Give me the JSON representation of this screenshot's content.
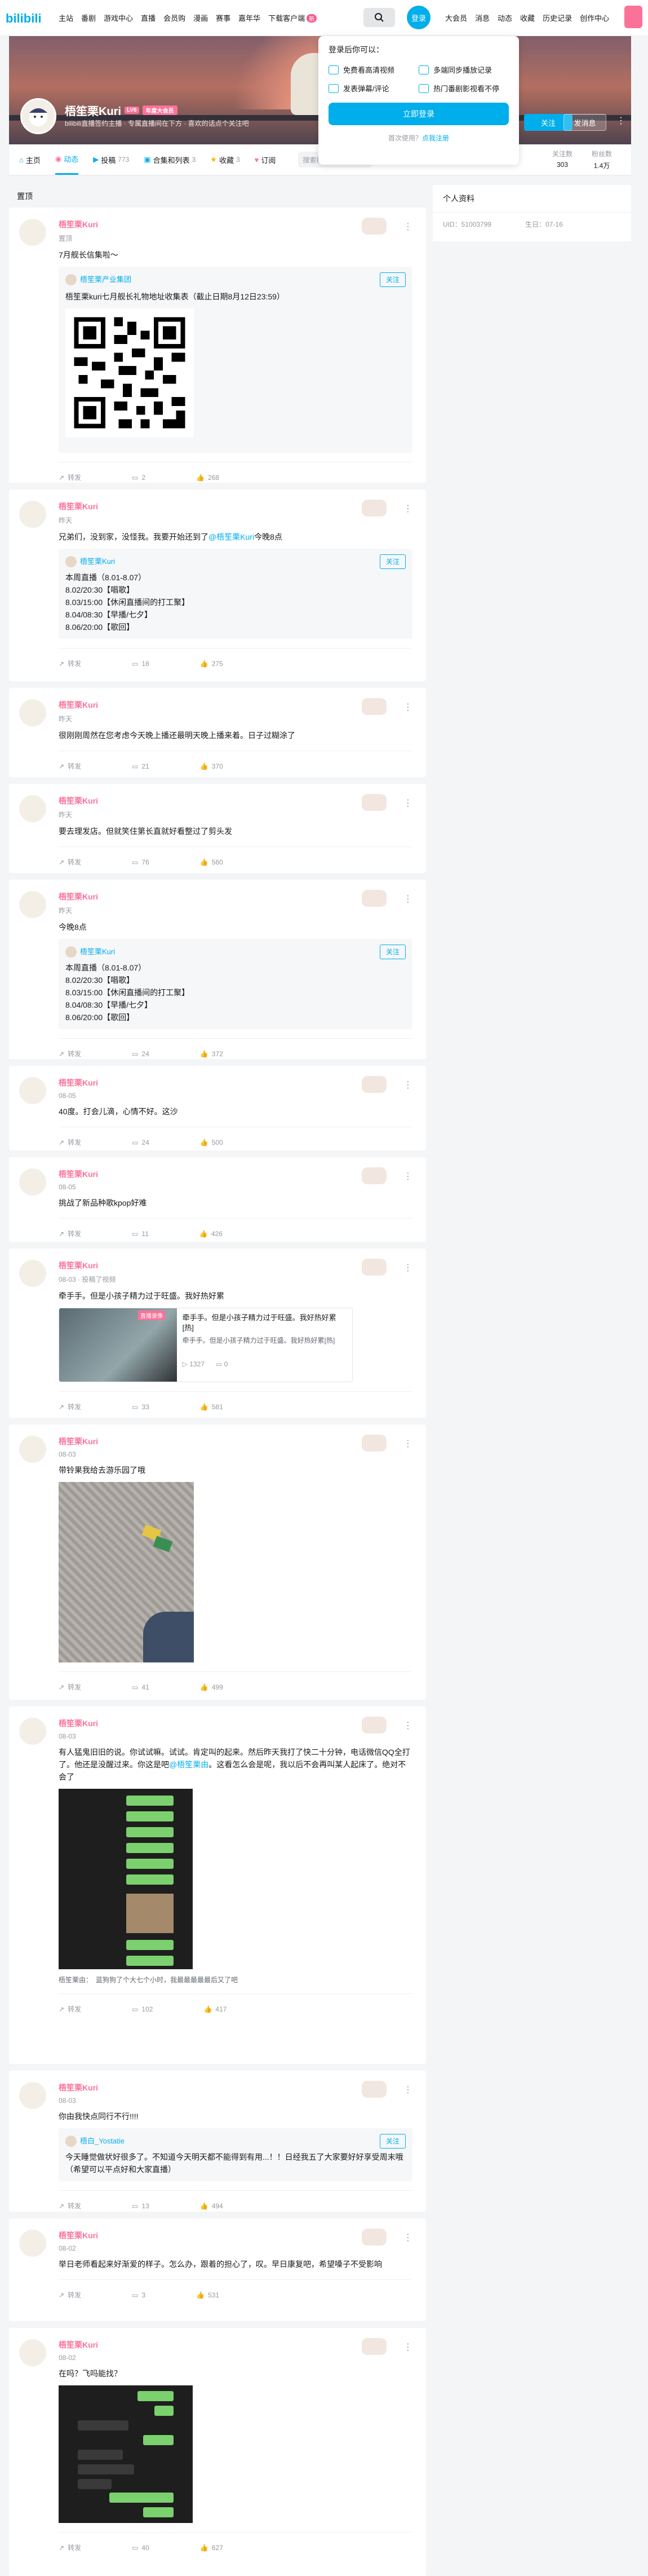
{
  "topnav": {
    "items": [
      "主站",
      "番剧",
      "游戏中心",
      "直播",
      "会员购",
      "漫画",
      "赛事",
      "嘉年华"
    ],
    "download": "下载客户端",
    "download_badge": "新",
    "login_circle": "登录",
    "right_items": [
      "大会员",
      "消息",
      "动态",
      "收藏",
      "历史记录",
      "创作中心"
    ]
  },
  "login_popup": {
    "heading": "登录后你可以：",
    "benefits": [
      "免费看高清视频",
      "多端同步播放记录",
      "发表弹幕/评论",
      "热门番剧影视看不停"
    ],
    "login_button": "立即登录",
    "first_use": "首次使用？",
    "register_link": "点我注册"
  },
  "profile": {
    "name": "梧笙栗Kuri",
    "level": "LV6",
    "vip": "年度大会员",
    "sign": "bilibili直播签约主播 · 专属直播间在下方 · 喜欢的话点个关注吧",
    "follow_button": "关注",
    "message_button": "发消息"
  },
  "tabs": [
    {
      "label": "主页",
      "count": ""
    },
    {
      "label": "动态",
      "count": ""
    },
    {
      "label": "投稿",
      "count": "773"
    },
    {
      "label": "合集和列表",
      "count": "3"
    },
    {
      "label": "收藏",
      "count": "3"
    },
    {
      "label": "订阅",
      "count": ""
    }
  ],
  "tab_search_placeholder": "搜索视频、动态",
  "stats": [
    {
      "label": "关注数",
      "value": "303"
    },
    {
      "label": "粉丝数",
      "value": "1.4万"
    }
  ],
  "sidebar": {
    "title": "个人资料",
    "uid": "UID：51003799",
    "birthday": "生日：07-16"
  },
  "feed_header": "置顶",
  "posts": [
    {
      "name": "梧笙栗Kuri",
      "time": "置顶",
      "text": "7月舰长信集啦～",
      "repost_name": "梧笙栗产业集团",
      "repost_follow": "关注",
      "repost_text": "梧笙栗kuri七月舰长礼物地址收集表（截止日期8月12日23:59）",
      "share": "转发",
      "comment": "2",
      "like": "268"
    },
    {
      "name": "梧笙栗Kuri",
      "time": "昨天",
      "text_a": "兄弟们，没到家，没怪我。我要开始还到了",
      "text_at": "@梧笙栗Kuri",
      "text_b": "今晚8点",
      "repost_name": "梧笙栗Kuri",
      "repost_follow": "关注",
      "repost_lines": [
        "本周直播（8.01-8.07）",
        "8.02/20:30【唱歌】",
        "8.03/15:00【休闲直播间的打工聚】",
        "8.04/08:30【早播/七夕】",
        "8.06/20:00【歌回】"
      ],
      "share": "转发",
      "comment": "18",
      "like": "275"
    },
    {
      "name": "梧笙栗Kuri",
      "time": "昨天",
      "text": "很刚刚周然在您考虑今天晚上播还最明天晚上播来着。日子过糊涂了",
      "share": "转发",
      "comment": "21",
      "like": "370"
    },
    {
      "name": "梧笙栗Kuri",
      "time": "昨天",
      "text": "要去理发店。但就笑住第长直就好看整过了剪头发",
      "share": "转发",
      "comment": "76",
      "like": "560"
    },
    {
      "name": "梧笙栗Kuri",
      "time": "昨天",
      "text": "今晚8点",
      "repost_name": "梧笙栗Kuri",
      "repost_follow": "关注",
      "repost_lines": [
        "本周直播（8.01-8.07）",
        "8.02/20:30【唱歌】",
        "8.03/15:00【休闲直播间的打工聚】",
        "8.04/08:30【早播/七夕】",
        "8.06/20:00【歌回】"
      ],
      "share": "转发",
      "comment": "24",
      "like": "372"
    },
    {
      "name": "梧笙栗Kuri",
      "time": "08-05",
      "text": "40度。打会儿滴，心情不好。这沙",
      "share": "转发",
      "comment": "24",
      "like": "500"
    },
    {
      "name": "梧笙栗Kuri",
      "time": "08-05",
      "text": "挑战了新品种歌kpop好难",
      "share": "转发",
      "comment": "11",
      "like": "426"
    },
    {
      "name": "梧笙栗Kuri",
      "time": "08-03 · 投稿了视频",
      "text": "牵手手。但是小孩子精力过于旺盛。我好热好累",
      "video_tag": "直播录像",
      "video_title": "牵手手。但是小孩子精力过于旺盛。我好热好累[热]",
      "video_desc": "牵手手。但是小孩子精力过于旺盛。我好热好累[热]",
      "video_views": "1327",
      "video_danmaku": "0",
      "share": "转发",
      "comment": "33",
      "like": "581"
    },
    {
      "name": "梧笙栗Kuri",
      "time": "08-03",
      "text": "带铃果",
      "text_b": "我给去游乐园了哦",
      "share": "转发",
      "comment": "41",
      "like": "499"
    },
    {
      "name": "梧笙栗Kuri",
      "time": "08-03",
      "text": "有人猛鬼旧旧的说。你试试嘛。试试。肯定叫的起来。然后昨天我打了快二十分钟，电话微信QQ全打了。他还是没醒过来。你这是吧",
      "text_at": "@梧笙栗由",
      "text_b": "。这看怎么会是呢，我以后不会再叫某人起床了。绝对不会了",
      "comment_user": "梧笙栗由：",
      "comment_text": "蓝狗狗了个大七个小时，我最最最最最后又了吧",
      "share": "转发",
      "comment": "102",
      "like": "417"
    },
    {
      "name": "梧笙栗Kuri",
      "time": "08-03",
      "text": "你由我快点同行不行!!!!",
      "repost_name": "梧白_Yostatie",
      "repost_follow": "关注",
      "repost_text": "今天睡觉做状好很多了。不知道今天明天都不能得到有用...！！日经我五了大家要好好享受周末哦（希望可以平点好和大家直播）",
      "share": "转发",
      "comment": "13",
      "like": "494"
    },
    {
      "name": "梧笙栗Kuri",
      "time": "08-02",
      "text": "举日老师看起来好渐爱的样子。怎么办，跟着的担心了，叹。早日康复吧，希望嗓子不受影响",
      "share": "转发",
      "comment": "3",
      "like": "531"
    },
    {
      "name": "梧笙栗Kuri",
      "time": "08-02",
      "text": "在吗？飞吗能找？",
      "share": "转发",
      "comment": "40",
      "like": "627"
    }
  ]
}
